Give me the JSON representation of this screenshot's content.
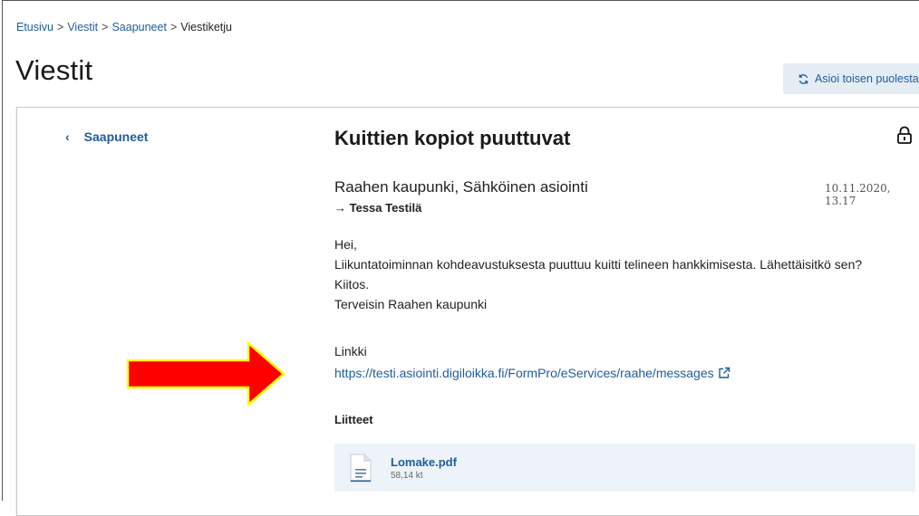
{
  "breadcrumb": {
    "items": [
      "Etusivu",
      "Viestit",
      "Saapuneet"
    ],
    "current": "Viestiketju",
    "separator": ">"
  },
  "page": {
    "title": "Viestit"
  },
  "proxy_button": {
    "label": "Asioi toisen puolesta",
    "icon": "refresh-icon"
  },
  "sidebar": {
    "back_label": "Saapuneet",
    "back_icon": "chevron-left-icon"
  },
  "message": {
    "subject": "Kuittien kopiot puuttuvat",
    "sender": "Raahen kaupunki, Sähköinen asiointi",
    "recipient_arrow": "→",
    "recipient": "Tessa Testilä",
    "date": "10.11.2020, 13.17",
    "body_lines": [
      "Hei,",
      "Liikuntatoiminnan kohdeavustuksesta puuttuu kuitti telineen hankkimisesta. Lähettäisitkö sen?",
      "Kiitos.",
      "Terveisin Raahen kaupunki"
    ],
    "link_heading": "Linkki",
    "link_url": "https://testi.asiointi.digiloikka.fi/FormPro/eServices/raahe/messages",
    "attachments_heading": "Liitteet",
    "attachments": [
      {
        "name": "Lomake.pdf",
        "size": "58,14 kt"
      }
    ]
  },
  "colors": {
    "link": "#1f5d9c",
    "button_bg": "#e4ecf4",
    "attachment_bg": "#edf3f9",
    "arrow_fill": "#ff0000",
    "arrow_stroke": "#ffff00"
  }
}
